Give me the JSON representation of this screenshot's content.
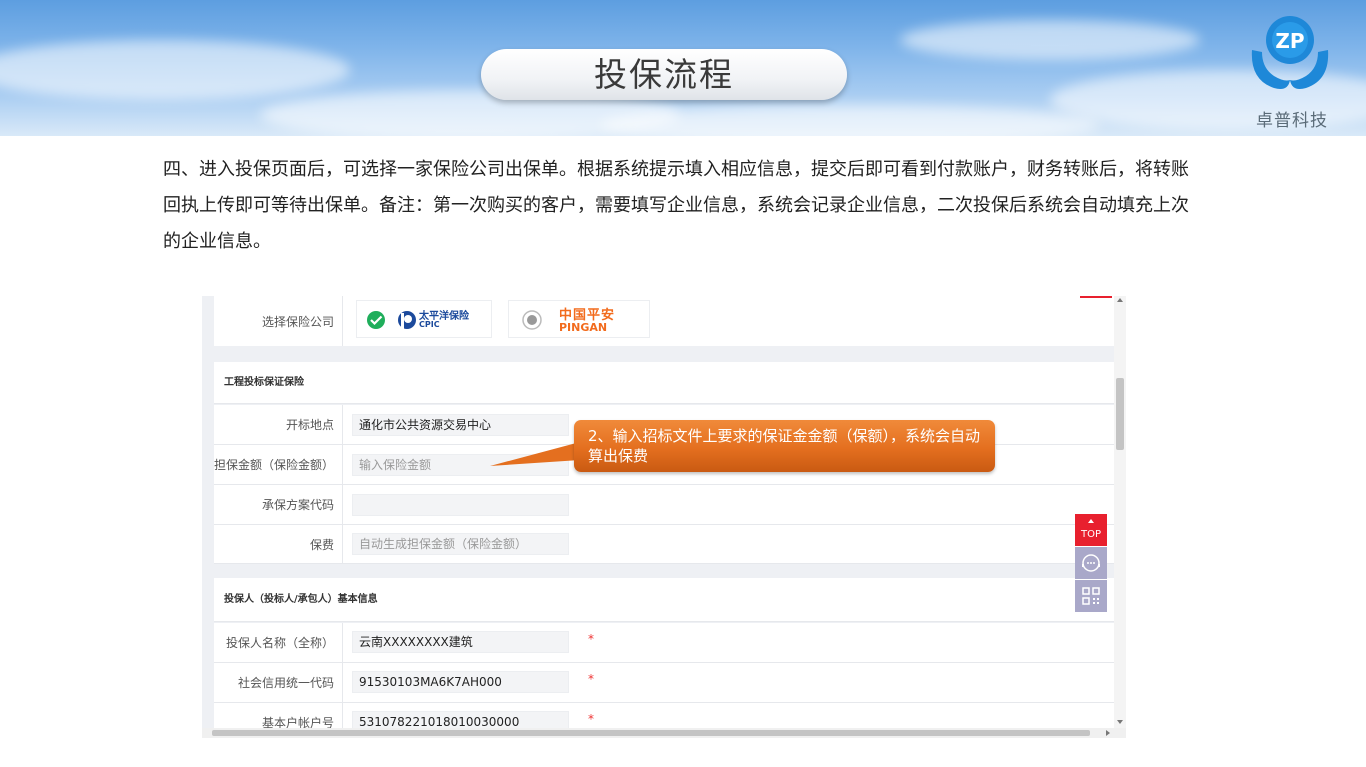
{
  "page": {
    "title": "投保流程",
    "brand": "卓普科技",
    "logo_letters": "ZP"
  },
  "description": "四、进入投保页面后，可选择一家保险公司出保单。根据系统提示填入相应信息，提交后即可看到付款账户，财务转账后，将转账回执上传即可等待出保单。备注：第一次购买的客户，需要填写企业信息，系统会记录企业信息，二次投保后系统会自动填充上次的企业信息。",
  "form": {
    "company_label": "选择保险公司",
    "companies": [
      {
        "name_cn": "太平洋保险",
        "name_en": "CPIC",
        "selected": true
      },
      {
        "name_cn": "中国平安",
        "name_en": "PINGAN",
        "selected": false
      }
    ],
    "section1_title": "工程投标保证保险",
    "fields1": [
      {
        "label": "开标地点",
        "value": "通化市公共资源交易中心",
        "placeholder": ""
      },
      {
        "label": "担保金额（保险金额）",
        "value": "",
        "placeholder": "输入保险金额"
      },
      {
        "label": "承保方案代码",
        "value": "",
        "placeholder": ""
      },
      {
        "label": "保费",
        "value": "",
        "placeholder": "自动生成担保金额（保险金额）"
      }
    ],
    "section2_title": "投保人（投标人/承包人）基本信息",
    "fields2": [
      {
        "label": "投保人名称（全称）",
        "value": "云南XXXXXXXX建筑",
        "required": "*"
      },
      {
        "label": "社会信用统一代码",
        "value": "91530103MA6K7AH000",
        "required": "*"
      },
      {
        "label": "基本户帐户号",
        "value": "531078221018010030000",
        "required": "*"
      }
    ]
  },
  "callout": "2、输入招标文件上要求的保证金金额（保额），系统会自动算出保费",
  "side_tools": {
    "top_label": "TOP",
    "top_color": "#e8202e"
  },
  "colors": {
    "accent_orange": "#e46f1f",
    "check_green": "#1fae5b",
    "pingan_orange": "#f26b1d",
    "cpic_blue": "#1c4a9c"
  }
}
